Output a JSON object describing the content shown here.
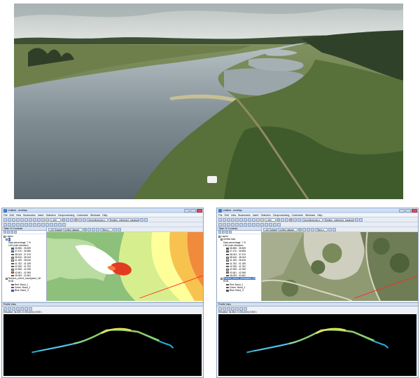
{
  "windows": [
    {
      "title": "Untitled - ArcMap",
      "menus": [
        "File",
        "Edit",
        "View",
        "Bookmarks",
        "Insert",
        "Selection",
        "Geoprocessing",
        "Customize",
        "Windows",
        "Help"
      ],
      "toolbar": {
        "scale": "1:150",
        "georef_label": "Georeferencing ▾",
        "layer_select": "Rubiere_orthofoto1_bandpanel.tif"
      },
      "toc": {
        "title": "Table Of Contents",
        "items": [
          {
            "label": "Layers",
            "level": 0
          },
          {
            "label": "...",
            "level": 1
          },
          {
            "label": "Data percentage: 7 %",
            "level": 2
          },
          {
            "label": "LAS point elevation",
            "level": 2
          },
          {
            "label": "36.896 - 35.839",
            "level": 3,
            "swatch": "#2c7bb6"
          },
          {
            "label": "37.470 - 36.896",
            "level": 3,
            "swatch": "#44a5c2"
          },
          {
            "label": "38.043 - 37.470",
            "level": 3,
            "swatch": "#7cc6a4"
          },
          {
            "label": "38.616 - 38.043",
            "level": 3,
            "swatch": "#abdda4"
          },
          {
            "label": "41.189 - 38.616",
            "level": 3,
            "swatch": "#d7ee8e"
          },
          {
            "label": "41.762 - 41.189",
            "level": 3,
            "swatch": "#ffffbf"
          },
          {
            "label": "42.335 - 41.762",
            "level": 3,
            "swatch": "#fee08b"
          },
          {
            "label": "42.908 - 42.335",
            "level": 3,
            "swatch": "#fdae61"
          },
          {
            "label": "43.481 - 42.908",
            "level": 3,
            "swatch": "#f46d43"
          },
          {
            "label": "45.053 - 43.481",
            "level": 3,
            "swatch": "#d7191c"
          },
          {
            "label": "Rubiere_ortho1_bandpanel_f.tif",
            "level": 1
          },
          {
            "label": "RGB",
            "level": 2
          },
          {
            "label": "Red: Band_1",
            "level": 3,
            "swatch": "#e03030"
          },
          {
            "label": "Green: Band_2",
            "level": 3,
            "swatch": "#30b030"
          },
          {
            "label": "Blue: Band_3",
            "level": 3,
            "swatch": "#3050e0"
          }
        ]
      },
      "map_toolbar": {
        "las_dataset": "LAS Dataset ▾",
        "layer": "Unified dataset",
        "filters": "Filters ▾"
      },
      "profile": {
        "title": "Profile View",
        "status": "Elevation: 44.625 • 0.000 (mm) 0.000 •"
      }
    },
    {
      "title": "Untitled - ArcMap",
      "menus": [
        "File",
        "Edit",
        "View",
        "Bookmarks",
        "Insert",
        "Selection",
        "Geoprocessing",
        "Customize",
        "Windows",
        "Help"
      ],
      "toolbar": {
        "scale": "1:150",
        "georef_label": "Georeferencing ▾",
        "layer_select": "Rubiere_orthofoto1_bandpanel.tif"
      },
      "toc": {
        "title": "Table Of Contents",
        "items": [
          {
            "label": "Layers",
            "level": 0
          },
          {
            "label": "Unified.lasd",
            "level": 1
          },
          {
            "label": "Data percentage: 7 %",
            "level": 2
          },
          {
            "label": "LAS point elevation",
            "level": 2
          },
          {
            "label": "36.896 - 35.839",
            "level": 3,
            "swatch": "#2c7bb6"
          },
          {
            "label": "37.470 - 36.896",
            "level": 3,
            "swatch": "#44a5c2"
          },
          {
            "label": "38.043 - 37.470",
            "level": 3,
            "swatch": "#7cc6a4"
          },
          {
            "label": "38.616 - 38.043",
            "level": 3,
            "swatch": "#abdda4"
          },
          {
            "label": "41.189 - 38.616",
            "level": 3,
            "swatch": "#d7ee8e"
          },
          {
            "label": "41.762 - 41.189",
            "level": 3,
            "swatch": "#ffffbf"
          },
          {
            "label": "42.335 - 41.762",
            "level": 3,
            "swatch": "#fee08b"
          },
          {
            "label": "42.908 - 42.335",
            "level": 3,
            "swatch": "#fdae61"
          },
          {
            "label": "43.481 - 42.908",
            "level": 3,
            "swatch": "#f46d43"
          },
          {
            "label": "45.053 - 43.481",
            "level": 3,
            "swatch": "#d7191c"
          },
          {
            "label": "Rubiere_ortho1_bandpanel_f.tif",
            "level": 1
          },
          {
            "label": "RGB",
            "level": 2
          },
          {
            "label": "Red: Band_1",
            "level": 3,
            "swatch": "#e03030"
          },
          {
            "label": "Green: Band_2",
            "level": 3,
            "swatch": "#30b030"
          },
          {
            "label": "Blue: Band_3",
            "level": 3,
            "swatch": "#3050e0"
          }
        ]
      },
      "map_toolbar": {
        "las_dataset": "LAS Dataset ▾",
        "layer": "Unified dataset",
        "filters": "Filters ▾"
      },
      "profile": {
        "title": "Profile View",
        "status": "Elevation: 46.384 • 0.000 (mm) 0.000 •"
      }
    }
  ],
  "colors": {
    "window_border": "#8fa4c2",
    "selection": "#3a76d0",
    "profile_line": "#ff2a1f"
  }
}
